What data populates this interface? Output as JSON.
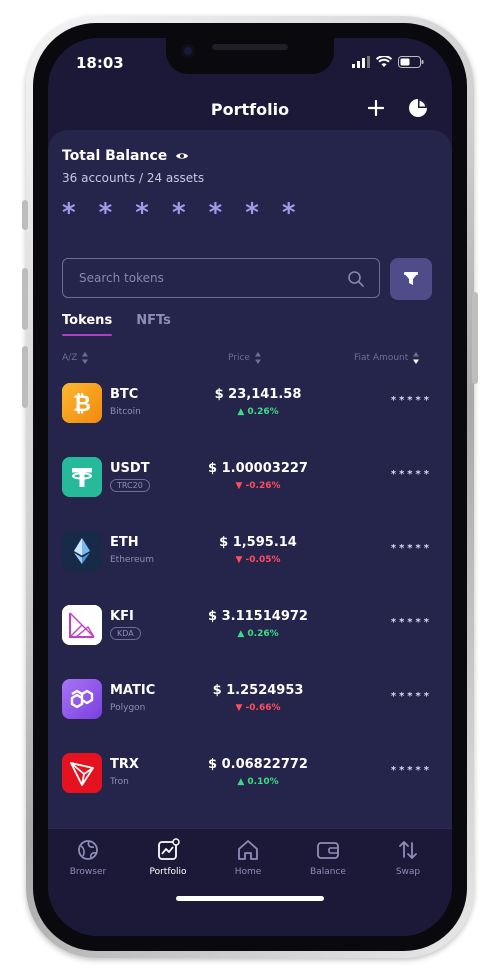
{
  "status": {
    "time": "18:03"
  },
  "header": {
    "title": "Portfolio"
  },
  "balance": {
    "label": "Total Balance",
    "accounts": "36 accounts / 24 assets",
    "masked": "* * * * * * *"
  },
  "search": {
    "placeholder": "Search tokens"
  },
  "tabs": [
    {
      "label": "Tokens"
    },
    {
      "label": "NFTs"
    }
  ],
  "columns": {
    "name": "A/Z",
    "price": "Price",
    "fiat": "Fiat Amount"
  },
  "tokens": [
    {
      "symbol": "BTC",
      "name": "Bitcoin",
      "price": "$ 23,141.58",
      "change": "0.26%",
      "direction": "up",
      "fiat": "*****",
      "color": "#f7a21a"
    },
    {
      "symbol": "USDT",
      "name": "TRC20",
      "price": "$ 1.00003227",
      "change": "-0.26%",
      "direction": "down",
      "fiat": "*****",
      "color": "#26b99a"
    },
    {
      "symbol": "ETH",
      "name": "Ethereum",
      "price": "$ 1,595.14",
      "change": "-0.05%",
      "direction": "down",
      "fiat": "*****",
      "color": "#172a47"
    },
    {
      "symbol": "KFI",
      "name": "KDA",
      "price": "$ 3.11514972",
      "change": "0.26%",
      "direction": "up",
      "fiat": "*****",
      "color": "#ffffff"
    },
    {
      "symbol": "MATIC",
      "name": "Polygon",
      "price": "$ 1.2524953",
      "change": "-0.66%",
      "direction": "down",
      "fiat": "*****",
      "color": "#8247e5"
    },
    {
      "symbol": "TRX",
      "name": "Tron",
      "price": "$ 0.06822772",
      "change": "0.10%",
      "direction": "up",
      "fiat": "*****",
      "color": "#e5131f"
    }
  ],
  "nav": [
    {
      "label": "Browser",
      "icon": "globe-icon"
    },
    {
      "label": "Portfolio",
      "icon": "portfolio-chart-icon",
      "active": true
    },
    {
      "label": "Home",
      "icon": "home-icon"
    },
    {
      "label": "Balance",
      "icon": "wallet-icon"
    },
    {
      "label": "Swap",
      "icon": "swap-icon"
    }
  ],
  "colors": {
    "background": "#1b1937",
    "card": "#25244a",
    "accent": "#b13ec9",
    "up": "#3ddc84",
    "down": "#ff4d5e"
  }
}
